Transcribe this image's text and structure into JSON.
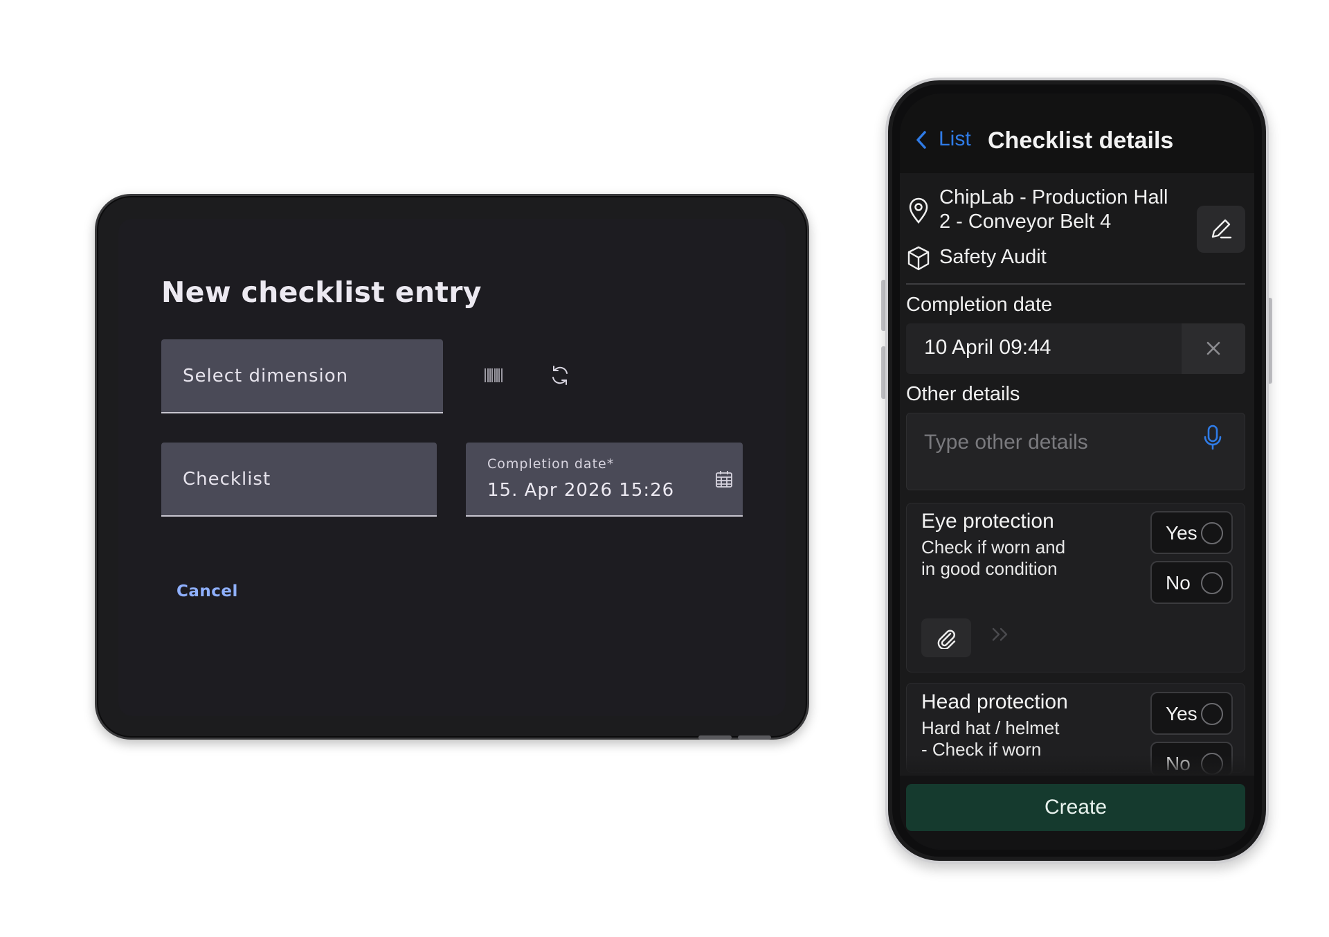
{
  "tablet": {
    "title": "New checklist entry",
    "select_dimension": "Select dimension",
    "checklist": "Checklist",
    "completion_date_label": "Completion date*",
    "completion_date_value": "15. Apr 2026 15:26",
    "cancel": "Cancel"
  },
  "phone": {
    "back_label": "List",
    "title": "Checklist details",
    "location": "ChipLab - Production Hall 2 - Conveyor Belt 4",
    "location_line1": "ChipLab - Production Hall",
    "location_line2": "2  - Conveyor Belt 4",
    "audit_type": "Safety Audit",
    "completion_date_label": "Completion date",
    "completion_date_value": "10 April 09:44",
    "other_details_label": "Other details",
    "other_details_placeholder": "Type other details",
    "questions": [
      {
        "title": "Eye protection",
        "subtitle_line1": "Check if worn and",
        "subtitle_line2": "in good condition",
        "yes": "Yes",
        "no": "No"
      },
      {
        "title": "Head protection",
        "subtitle_line1": "Hard hat / helmet",
        "subtitle_line2": "- Check if worn",
        "yes": "Yes",
        "no": "No"
      }
    ],
    "create": "Create"
  },
  "colors": {
    "accent_blue": "#2f7be6",
    "cancel_blue": "#8fb0ff",
    "create_green": "#153a2e",
    "field_bg": "#4a4a57"
  },
  "icons": [
    "barcode-icon",
    "refresh-icon",
    "calendar-icon",
    "chevron-left-icon",
    "location-pin-icon",
    "box-icon",
    "edit-pencil-icon",
    "close-icon",
    "microphone-icon",
    "paperclip-icon",
    "chevrons-right-icon"
  ]
}
